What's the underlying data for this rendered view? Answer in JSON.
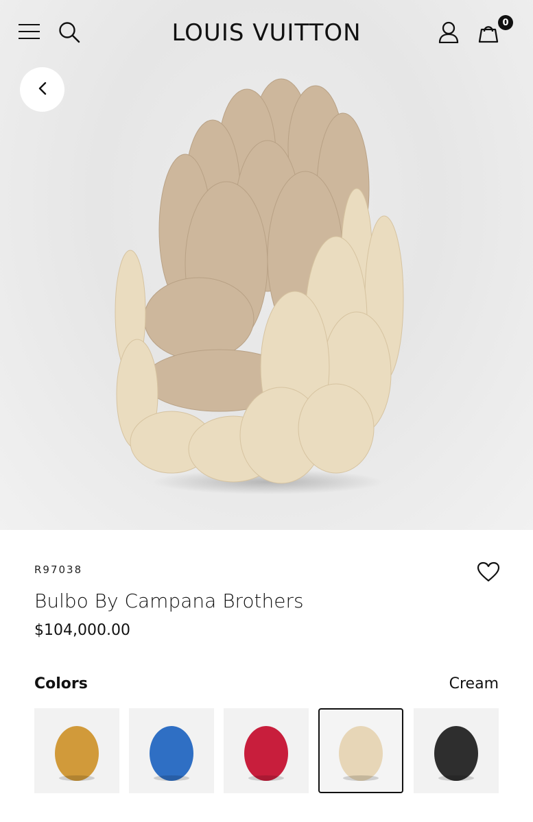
{
  "header": {
    "brand": "LOUIS VUITTON",
    "cart_count": "0",
    "icons": [
      "menu-icon",
      "search-icon",
      "user-icon",
      "shopping-bag-icon"
    ]
  },
  "hero": {
    "back_icon": "chevron-left-icon"
  },
  "product": {
    "sku": "R97038",
    "name": "Bulbo By Campana Brothers",
    "price": "$104,000.00"
  },
  "colors": {
    "label": "Colors",
    "selected": "Cream",
    "options": [
      {
        "name": "Yellow",
        "hex": "#d19a3a"
      },
      {
        "name": "Blue",
        "hex": "#2f6fc4"
      },
      {
        "name": "Red",
        "hex": "#c81e3c"
      },
      {
        "name": "Cream",
        "hex": "#e7d6b7"
      },
      {
        "name": "Black",
        "hex": "#2e2e2e"
      }
    ]
  }
}
